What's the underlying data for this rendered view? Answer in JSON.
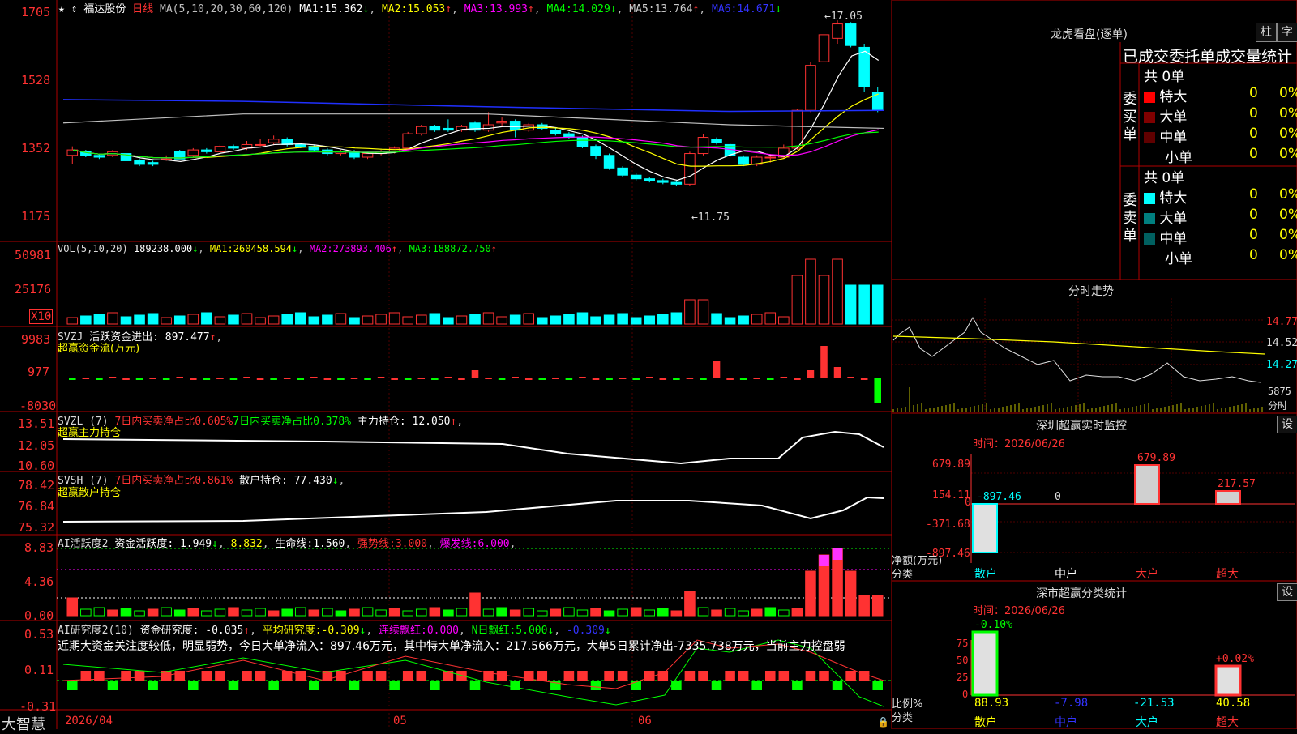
{
  "colors": {
    "up": "#ff3232",
    "down": "#00ffff",
    "ma1": "#ffffff",
    "ma2": "#ffff00",
    "ma3": "#ff00ff",
    "ma4": "#00ff00",
    "ma5": "#c0c0c0",
    "ma6": "#0000ff",
    "bg": "#000000",
    "grid": "#b00000"
  },
  "header": {
    "star_icon": "star-icon",
    "stock_name": "福达股份",
    "period": "日线",
    "ma_def": "MA(5,10,20,30,60,120)",
    "ma": [
      {
        "label": "MA1:",
        "value": "15.362",
        "arrow": "↓",
        "color": "#ffffff"
      },
      {
        "label": "MA2:",
        "value": "15.053",
        "arrow": "↑",
        "color": "#ffff00"
      },
      {
        "label": "MA3:",
        "value": "13.993",
        "arrow": "↑",
        "color": "#ff00ff"
      },
      {
        "label": "MA4:",
        "value": "14.029",
        "arrow": "↓",
        "color": "#00ff00"
      },
      {
        "label": "MA5:",
        "value": "13.764",
        "arrow": "↑",
        "color": "#c0c0c0"
      },
      {
        "label": "MA6:",
        "value": "14.671",
        "arrow": "↓",
        "color": "#0000ff"
      }
    ]
  },
  "main_chart": {
    "y_labels": [
      "1705",
      "1528",
      "1352",
      "1175"
    ],
    "price_range": [
      11.0,
      17.3
    ],
    "high_mark": "17.05",
    "low_mark": "11.75",
    "candles": [
      [
        13.3,
        13.45,
        13.55,
        13.05
      ],
      [
        13.4,
        13.3,
        13.45,
        13.25
      ],
      [
        13.3,
        13.25,
        13.35,
        13.2
      ],
      [
        13.3,
        13.4,
        13.45,
        13.25
      ],
      [
        13.35,
        13.15,
        13.4,
        13.1
      ],
      [
        13.15,
        13.05,
        13.2,
        13.0
      ],
      [
        13.1,
        13.05,
        13.15,
        13.0
      ],
      [
        13.2,
        13.2,
        13.3,
        13.15
      ],
      [
        13.4,
        13.2,
        13.45,
        13.2
      ],
      [
        13.3,
        13.45,
        13.5,
        13.25
      ],
      [
        13.45,
        13.4,
        13.5,
        13.35
      ],
      [
        13.4,
        13.55,
        13.6,
        13.35
      ],
      [
        13.55,
        13.5,
        13.6,
        13.45
      ],
      [
        13.5,
        13.6,
        13.7,
        13.45
      ],
      [
        13.6,
        13.6,
        13.75,
        13.55
      ],
      [
        13.65,
        13.75,
        13.85,
        13.6
      ],
      [
        13.75,
        13.6,
        13.8,
        13.55
      ],
      [
        13.6,
        13.55,
        13.65,
        13.5
      ],
      [
        13.55,
        13.45,
        13.6,
        13.4
      ],
      [
        13.45,
        13.35,
        13.5,
        13.3
      ],
      [
        13.35,
        13.4,
        13.45,
        13.3
      ],
      [
        13.4,
        13.25,
        13.45,
        13.2
      ],
      [
        13.25,
        13.35,
        13.4,
        13.2
      ],
      [
        13.35,
        13.4,
        13.45,
        13.3
      ],
      [
        13.4,
        13.5,
        13.55,
        13.35
      ],
      [
        13.5,
        13.9,
        13.95,
        13.45
      ],
      [
        13.9,
        14.1,
        14.15,
        13.85
      ],
      [
        14.1,
        14.0,
        14.15,
        13.95
      ],
      [
        14.05,
        14.0,
        14.3,
        13.95
      ],
      [
        14.0,
        14.1,
        14.15,
        13.95
      ],
      [
        14.2,
        14.0,
        14.25,
        13.95
      ],
      [
        14.0,
        14.15,
        14.5,
        13.95
      ],
      [
        14.2,
        14.25,
        14.35,
        14.1
      ],
      [
        14.25,
        14.0,
        14.3,
        13.8
      ],
      [
        14.0,
        14.15,
        14.2,
        13.95
      ],
      [
        14.15,
        14.05,
        14.2,
        14.0
      ],
      [
        14.0,
        13.9,
        14.05,
        13.85
      ],
      [
        13.9,
        13.8,
        13.95,
        13.75
      ],
      [
        13.8,
        13.55,
        13.85,
        13.5
      ],
      [
        13.55,
        13.3,
        13.6,
        13.2
      ],
      [
        13.3,
        12.95,
        13.35,
        12.9
      ],
      [
        12.95,
        12.75,
        13.0,
        12.7
      ],
      [
        12.75,
        12.65,
        12.8,
        12.6
      ],
      [
        12.65,
        12.6,
        12.7,
        12.55
      ],
      [
        12.6,
        12.55,
        12.65,
        12.5
      ],
      [
        12.55,
        12.5,
        12.6,
        12.45
      ],
      [
        12.5,
        13.35,
        13.4,
        12.45
      ],
      [
        13.35,
        13.8,
        13.9,
        13.3
      ],
      [
        13.75,
        13.65,
        13.8,
        13.6
      ],
      [
        13.6,
        13.3,
        13.65,
        13.25
      ],
      [
        13.25,
        13.05,
        13.3,
        13.0
      ],
      [
        13.05,
        13.25,
        13.3,
        13.0
      ],
      [
        13.25,
        13.25,
        13.3,
        13.1
      ],
      [
        13.25,
        13.5,
        13.6,
        13.2
      ],
      [
        13.5,
        14.55,
        14.6,
        13.45
      ],
      [
        14.55,
        15.8,
        15.9,
        14.5
      ],
      [
        15.9,
        16.65,
        17.05,
        15.85
      ],
      [
        16.55,
        16.95,
        17.05,
        16.4
      ],
      [
        16.95,
        16.35,
        17.0,
        16.3
      ],
      [
        16.3,
        15.2,
        16.4,
        15.05
      ],
      [
        15.05,
        14.55,
        15.2,
        14.5
      ]
    ],
    "sessions": [
      0,
      15,
      30,
      46
    ]
  },
  "vol_panel": {
    "title": "VOL(5,10,20)",
    "value": "189238.000",
    "arrow": "↓",
    "ma": [
      {
        "label": "MA1:",
        "value": "260458.594",
        "arrow": "↓",
        "color": "#ffff00"
      },
      {
        "label": "MA2:",
        "value": "273893.406",
        "arrow": "↑",
        "color": "#ff00ff"
      },
      {
        "label": "MA3:",
        "value": "188872.750",
        "arrow": "↑",
        "color": "#00ff00"
      }
    ],
    "y_labels": [
      "50981",
      "25176"
    ],
    "unit": "X10"
  },
  "svzj_panel": {
    "title": "SVZJ",
    "label": "活跃资金进出:",
    "value": "897.477",
    "arrow": "↑",
    "subtitle": "超赢资金流(万元)",
    "y_labels": [
      "9983",
      "977",
      "-8030"
    ]
  },
  "svzl_panel": {
    "title": "SVZL (7)",
    "t1": "7日内买卖净占比0.605%",
    "t2": "7日内买卖净占比0.378%",
    "label": "主力持仓:",
    "value": "12.050",
    "arrow": "↑",
    "subtitle": "超赢主力持仓",
    "y_labels": [
      "13.51",
      "12.05",
      "10.60"
    ]
  },
  "svsh_panel": {
    "title": "SVSH (7)",
    "t1": "7日内买卖净占比0.861%",
    "label": "散户持仓:",
    "value": "77.430",
    "arrow": "↓",
    "subtitle": "超赢散户持仓",
    "y_labels": [
      "78.42",
      "76.84",
      "75.32"
    ]
  },
  "ai_active": {
    "title": "AI活跃度2",
    "label": "资金活跃度:",
    "value": "1.949",
    "arrow": "↓",
    "v2": "8.832",
    "life_label": "生命线:",
    "life": "1.560",
    "strong_label": "强势线:",
    "strong": "3.000",
    "burst_label": "爆发线:",
    "burst": "6.000",
    "y_labels": [
      "8.83",
      "4.36",
      "0.00"
    ]
  },
  "ai_research": {
    "title": "AI研究度2(10)",
    "label": "资金研究度:",
    "value": "-0.035",
    "arrow": "↑",
    "avg_label": "平均研究度:",
    "avg": "-0.309",
    "avg_arrow": "↓",
    "red_label": "连续飘红:",
    "red": "0.000",
    "nred_label": "N日飘红:",
    "nred": "5.000",
    "nred_arrow": "↓",
    "last": "-0.309",
    "last_arrow": "↓",
    "summary": "近期大资金关注度较低，明显弱势，今日大单净流入：897.46万元，其中特大单净流入：217.566万元，大单5日累计净出-7335.738万元，当前主力控盘弱",
    "y_labels": [
      "0.53",
      "0.11",
      "-0.31"
    ]
  },
  "bottom": {
    "brand": "大智慧",
    "dates": [
      "2026/04",
      "05",
      "06"
    ]
  },
  "dragon": {
    "title": "龙虎看盘(逐单)",
    "btn1": "柱",
    "btn2": "字",
    "header": "已成交委托单成交量统计",
    "buy": {
      "side": "委买单",
      "total": "共 0单",
      "rows": [
        {
          "label": "特大",
          "count": "0",
          "pct": "0%",
          "color": "#ff0000"
        },
        {
          "label": "大单",
          "count": "0",
          "pct": "0%",
          "color": "#800000"
        },
        {
          "label": "中单",
          "count": "0",
          "pct": "0%",
          "color": "#600000"
        },
        {
          "label": "小单",
          "count": "0",
          "pct": "0%",
          "color": ""
        }
      ]
    },
    "sell": {
      "side": "委卖单",
      "total": "共 0单",
      "rows": [
        {
          "label": "特大",
          "count": "0",
          "pct": "0%",
          "color": "#00ffff"
        },
        {
          "label": "大单",
          "count": "0",
          "pct": "0%",
          "color": "#008080"
        },
        {
          "label": "中单",
          "count": "0",
          "pct": "0%",
          "color": "#006060"
        },
        {
          "label": "小单",
          "count": "0",
          "pct": "0%",
          "color": ""
        }
      ]
    }
  },
  "minute": {
    "title": "分时走势",
    "y_labels": [
      "14.77",
      "14.52",
      "14.27"
    ],
    "vol_label": "5875",
    "vol_unit": "分时"
  },
  "monitor": {
    "title": "深圳超赢实时监控",
    "btn": "设",
    "time_label": "时间：2026/06/26",
    "y_labels": [
      "679.89",
      "154.11",
      "0",
      "-371.68",
      "-897.46"
    ],
    "bar_values": [
      "-897.46",
      "0",
      "679.89",
      "217.57"
    ],
    "categories": [
      "散户",
      "中户",
      "大户",
      "超大"
    ],
    "ylabel1": "净额(万元)",
    "ylabel2": "分类"
  },
  "classify": {
    "title": "深市超赢分类统计",
    "btn": "设",
    "time_label": "时间：2026/06/26",
    "y_labels": [
      "75",
      "50",
      "25",
      "0"
    ],
    "top_values": [
      "-0.10%",
      "+0.02%"
    ],
    "bottom_values": [
      "88.93",
      "-7.98",
      "-21.53",
      "40.58"
    ],
    "categories": [
      "散户",
      "中户",
      "大户",
      "超大"
    ],
    "ylabel1": "比例%",
    "ylabel2": "分类"
  }
}
